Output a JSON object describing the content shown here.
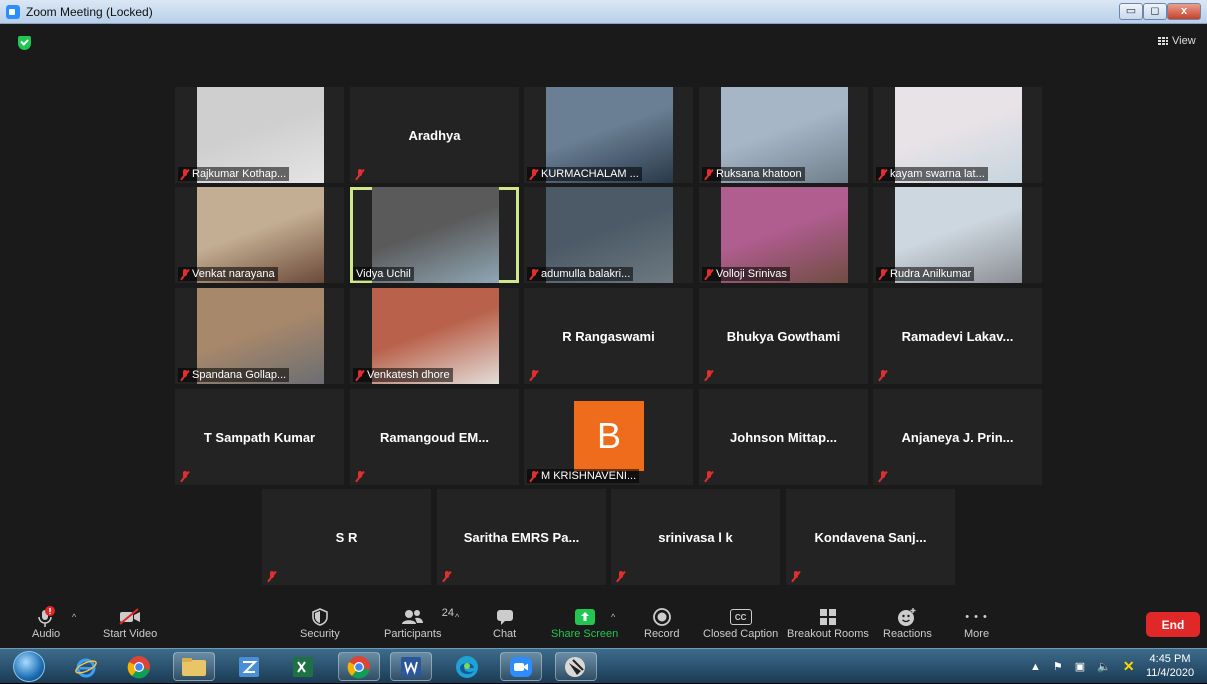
{
  "window": {
    "title": "Zoom Meeting (Locked)",
    "min": "▭",
    "max": "◻",
    "close": "x"
  },
  "header": {
    "view_label": "View"
  },
  "tiles": [
    {
      "name": "Rajkumar Kothap...",
      "video": true
    },
    {
      "name": "",
      "display_name": "Aradhya",
      "video": false
    },
    {
      "name": "KURMACHALAM ...",
      "video": true
    },
    {
      "name": "Ruksana khatoon",
      "video": true
    },
    {
      "name": "kayam swarna lat...",
      "video": true
    },
    {
      "name": "Venkat narayana",
      "video": true
    },
    {
      "name": "Vidya Uchil",
      "video": true,
      "active_speaker": true
    },
    {
      "name": "adumulla balakri...",
      "video": true
    },
    {
      "name": "Volloji Srinivas",
      "video": true
    },
    {
      "name": "Rudra Anilkumar",
      "video": true
    },
    {
      "name": "Spandana Gollap...",
      "video": true
    },
    {
      "name": "Venkatesh dhore",
      "video": true
    },
    {
      "name": "",
      "display_name": "R Rangaswami",
      "video": false
    },
    {
      "name": "",
      "display_name": "Bhukya Gowthami",
      "video": false
    },
    {
      "name": "",
      "display_name": "Ramadevi  Lakav...",
      "video": false
    },
    {
      "name": "",
      "display_name": "T Sampath Kumar",
      "video": false
    },
    {
      "name": "",
      "display_name": "Ramangoud  EM...",
      "video": false
    },
    {
      "name": "M KRISHNAVENI...",
      "avatar_letter": "B",
      "video": false
    },
    {
      "name": "",
      "display_name": "Johnson  Mittap...",
      "video": false
    },
    {
      "name": "",
      "display_name": "Anjaneya  J. Prin...",
      "video": false
    },
    {
      "name": "",
      "display_name": "S R",
      "video": false
    },
    {
      "name": "",
      "display_name": "Saritha  EMRS Pa...",
      "video": false
    },
    {
      "name": "",
      "display_name": "srinivasa l k",
      "video": false
    },
    {
      "name": "",
      "display_name": "Kondavena  Sanj...",
      "video": false
    }
  ],
  "toolbar": {
    "audio": "Audio",
    "start_video": "Start Video",
    "security": "Security",
    "participants": "Participants",
    "participants_count": "24",
    "chat": "Chat",
    "share_screen": "Share Screen",
    "record": "Record",
    "closed_caption": "Closed Caption",
    "breakout_rooms": "Breakout Rooms",
    "reactions": "Reactions",
    "more": "More",
    "end": "End",
    "cc_badge": "CC",
    "more_glyph": "• • •"
  },
  "colors": {
    "share_green": "#23c552",
    "end_red": "#e02828",
    "avatar_orange": "#ef6c1d",
    "active_border": "#cfe88a"
  },
  "taskbar": {
    "time": "4:45 PM",
    "date": "11/4/2020"
  }
}
